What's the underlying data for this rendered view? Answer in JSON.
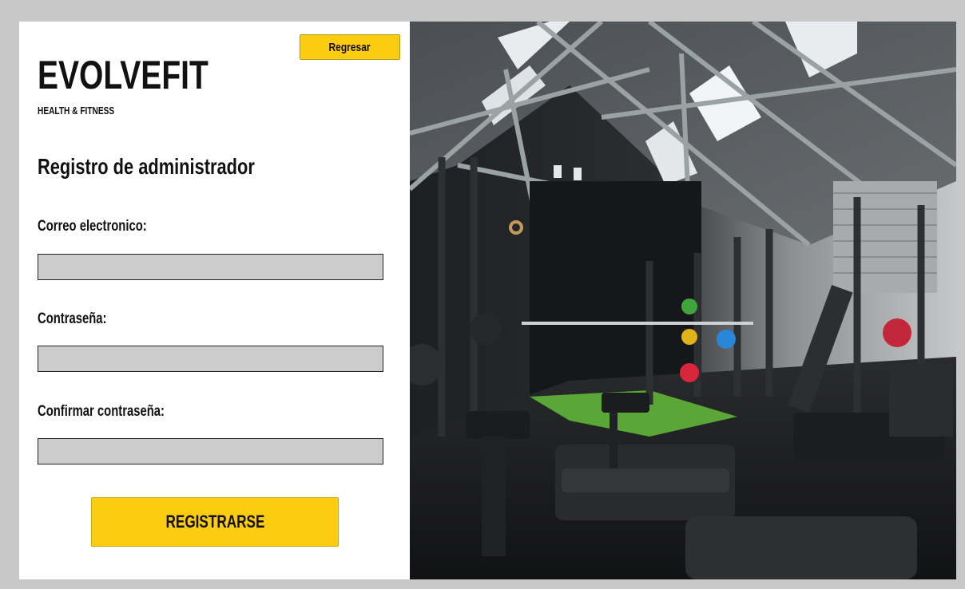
{
  "header": {
    "back_label": "Regresar"
  },
  "brand": {
    "name": "EVOLVEFIT",
    "tagline": "HEALTH & FITNESS"
  },
  "form": {
    "title": "Registro de administrador",
    "email_label": "Correo electronico:",
    "email_value": "",
    "password_label": "Contraseña:",
    "password_value": "",
    "confirm_label": "Confirmar contraseña:",
    "confirm_value": "",
    "submit_label": "REGISTRARSE"
  },
  "colors": {
    "accent": "#fccc10",
    "field_bg": "#cccccc",
    "page_bg": "#c8c8c8"
  }
}
